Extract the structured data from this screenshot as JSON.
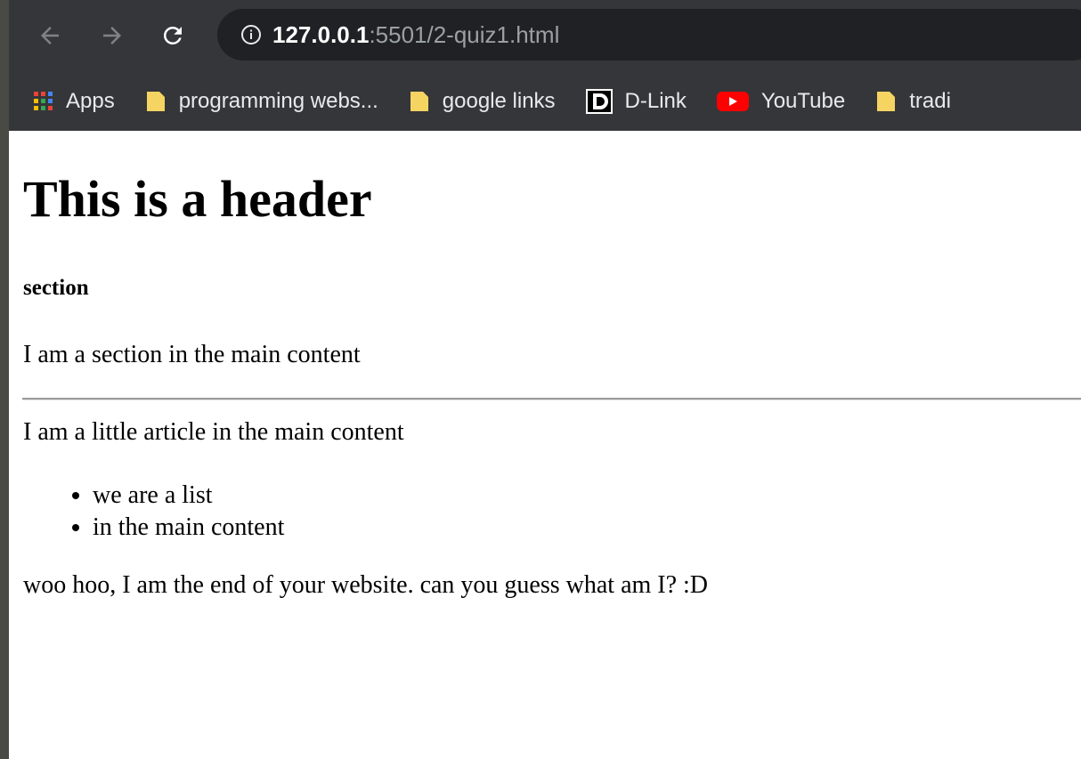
{
  "browser": {
    "url_host": "127.0.0.1",
    "url_path": ":5501/2-quiz1.html",
    "bookmarks": [
      {
        "label": "Apps",
        "icon": "apps-grid-icon"
      },
      {
        "label": "programming webs...",
        "icon": "folder-icon"
      },
      {
        "label": "google links",
        "icon": "folder-icon"
      },
      {
        "label": "D-Link",
        "icon": "dlink-icon"
      },
      {
        "label": "YouTube",
        "icon": "youtube-icon"
      },
      {
        "label": "tradi",
        "icon": "folder-icon"
      }
    ]
  },
  "page": {
    "header": "This is a header",
    "section_title": "section",
    "section_text": "I am a section in the main content",
    "article_text": "I am a little article in the main content",
    "list": [
      "we are a list",
      "in the main content"
    ],
    "footer_text": "woo hoo, I am the end of your website. can you guess what am I? :D"
  },
  "colors": {
    "chrome_bg": "#35363a",
    "omnibox_bg": "#202124",
    "folder": "#f6d462",
    "youtube": "#ff0000"
  }
}
